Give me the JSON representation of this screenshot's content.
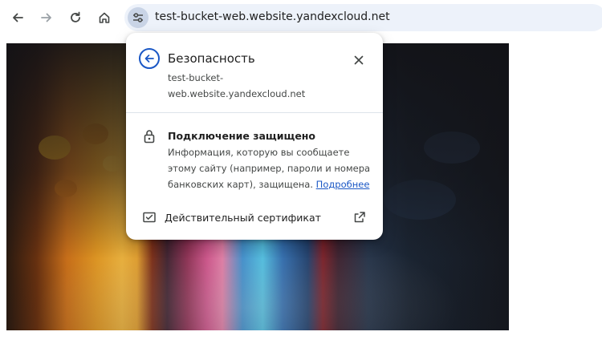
{
  "browser": {
    "url": "test-bucket-web.website.yandexcloud.net",
    "icons": {
      "back": "arrow-left-icon",
      "forward": "arrow-right-icon",
      "reload": "reload-icon",
      "home": "home-icon",
      "site_info": "tune-icon"
    }
  },
  "popup": {
    "title": "Безопасность",
    "url_line1": "test-bucket-",
    "url_line2": "web.website.yandexcloud.net",
    "connection": {
      "title": "Подключение защищено",
      "description": "Информация, которую вы сообщаете этому сайту (например, пароли и номера банковских карт), защищена.",
      "link": "Подробнее"
    },
    "certificate_label": "Действительный сертификат"
  },
  "colors": {
    "accent_blue": "#1a57c5",
    "omnibox_bg": "#edf2fa",
    "text_primary": "#1f1f1f",
    "text_secondary": "#444746"
  }
}
